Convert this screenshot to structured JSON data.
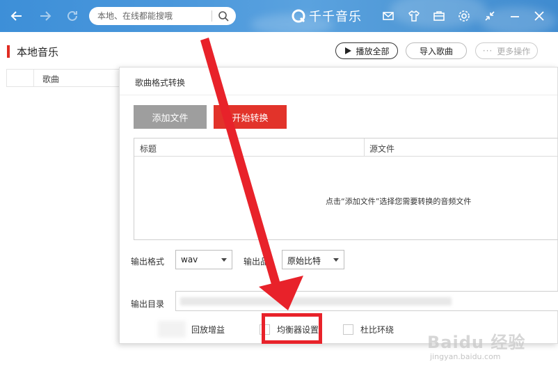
{
  "topbar": {
    "search_placeholder": "本地、在线都能搜哦",
    "brand": "千千音乐"
  },
  "page": {
    "title": "本地音乐",
    "buttons": {
      "play_all": "播放全部",
      "import": "导入歌曲",
      "more": "更多操作"
    },
    "column_song": "歌曲"
  },
  "dialog": {
    "title": "歌曲格式转换",
    "add_file": "添加文件",
    "start_convert": "开始转换",
    "table": {
      "col_title": "标题",
      "col_source": "源文件",
      "empty_hint": "点击“添加文件”选择您需要转换的音频文件"
    },
    "output_format_label": "输出格式",
    "output_format_value": "wav",
    "output_bitrate_label": "输出品",
    "output_bitrate_value": "原始比特",
    "output_dir_label": "输出目录",
    "options": {
      "replay_gain": "回放增益",
      "equalizer": "均衡器设置",
      "dolby": "杜比环绕"
    }
  },
  "watermark": {
    "main": "Baidu 经验",
    "sub": "jingyan.baidu.com"
  },
  "colors": {
    "accent": "#e2332a",
    "titlebar": "#4a97db",
    "annotation": "#e8222a"
  }
}
